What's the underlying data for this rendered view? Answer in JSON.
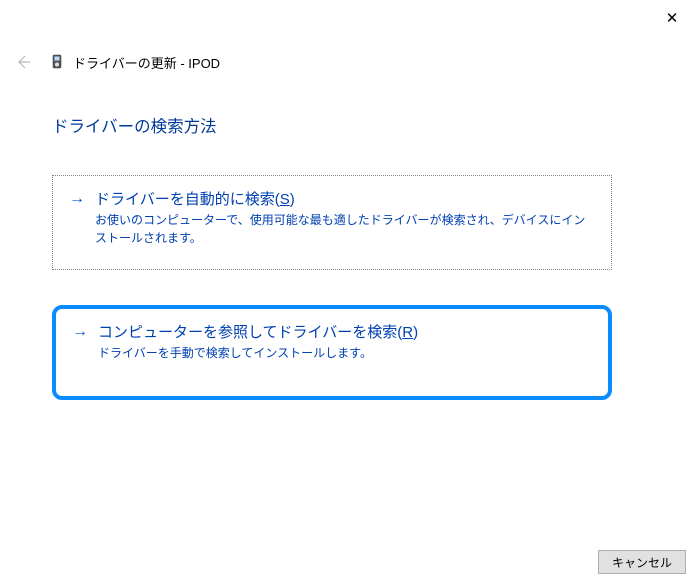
{
  "window": {
    "title": "ドライバーの更新 - IPOD",
    "close_label": "✕"
  },
  "heading": "ドライバーの検索方法",
  "options": {
    "auto": {
      "title_prefix": "ドライバーを自動的に検索(",
      "title_key": "S",
      "title_suffix": ")",
      "description": "お使いのコンピューターで、使用可能な最も適したドライバーが検索され、デバイスにインストールされます。"
    },
    "manual": {
      "title_prefix": "コンピューターを参照してドライバーを検索(",
      "title_key": "R",
      "title_suffix": ")",
      "description": "ドライバーを手動で検索してインストールします。"
    }
  },
  "buttons": {
    "cancel": "キャンセル"
  }
}
